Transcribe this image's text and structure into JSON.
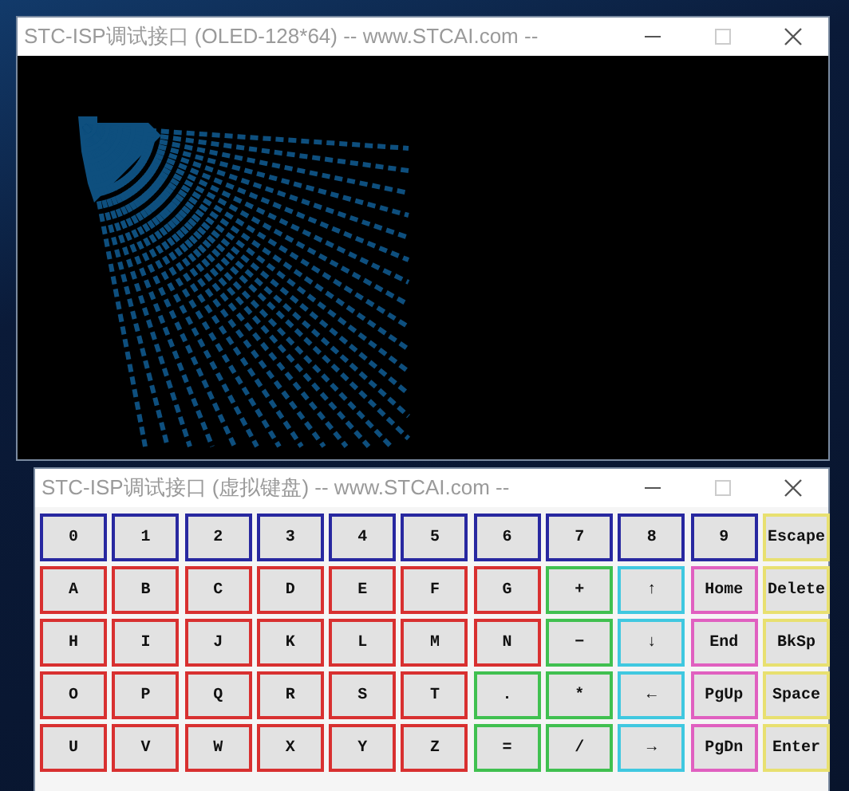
{
  "oled_window": {
    "title": "STC-ISP调试接口 (OLED-128*64) -- www.STCAI.com --"
  },
  "keyboard_window": {
    "title": "STC-ISP调试接口 (虚拟键盘) -- www.STCAI.com --",
    "rows": [
      {
        "keys": [
          {
            "label": "0",
            "color": "#2828a0"
          },
          {
            "label": "1",
            "color": "#2828a0"
          },
          {
            "label": "2",
            "color": "#2828a0"
          },
          {
            "label": "3",
            "color": "#2828a0"
          },
          {
            "label": "4",
            "color": "#2828a0"
          },
          {
            "label": "5",
            "color": "#2828a0"
          },
          {
            "label": "6",
            "color": "#2828a0"
          },
          {
            "label": "7",
            "color": "#2828a0"
          },
          {
            "label": "8",
            "color": "#2828a0"
          },
          {
            "label": "9",
            "color": "#2828a0"
          },
          {
            "label": "Escape",
            "color": "#e8e070"
          }
        ]
      },
      {
        "keys": [
          {
            "label": "A",
            "color": "#d83030"
          },
          {
            "label": "B",
            "color": "#d83030"
          },
          {
            "label": "C",
            "color": "#d83030"
          },
          {
            "label": "D",
            "color": "#d83030"
          },
          {
            "label": "E",
            "color": "#d83030"
          },
          {
            "label": "F",
            "color": "#d83030"
          },
          {
            "label": "G",
            "color": "#d83030"
          },
          {
            "label": "+",
            "color": "#40c050"
          },
          {
            "label": "↑",
            "color": "#40c8e0"
          },
          {
            "label": "Home",
            "color": "#e060c0"
          },
          {
            "label": "Delete",
            "color": "#e8e070"
          }
        ]
      },
      {
        "keys": [
          {
            "label": "H",
            "color": "#d83030"
          },
          {
            "label": "I",
            "color": "#d83030"
          },
          {
            "label": "J",
            "color": "#d83030"
          },
          {
            "label": "K",
            "color": "#d83030"
          },
          {
            "label": "L",
            "color": "#d83030"
          },
          {
            "label": "M",
            "color": "#d83030"
          },
          {
            "label": "N",
            "color": "#d83030"
          },
          {
            "label": "−",
            "color": "#40c050"
          },
          {
            "label": "↓",
            "color": "#40c8e0"
          },
          {
            "label": "End",
            "color": "#e060c0"
          },
          {
            "label": "BkSp",
            "color": "#e8e070"
          }
        ]
      },
      {
        "keys": [
          {
            "label": "O",
            "color": "#d83030"
          },
          {
            "label": "P",
            "color": "#d83030"
          },
          {
            "label": "Q",
            "color": "#d83030"
          },
          {
            "label": "R",
            "color": "#d83030"
          },
          {
            "label": "S",
            "color": "#d83030"
          },
          {
            "label": "T",
            "color": "#d83030"
          },
          {
            "label": ".",
            "color": "#40c050"
          },
          {
            "label": "*",
            "color": "#40c050"
          },
          {
            "label": "←",
            "color": "#40c8e0"
          },
          {
            "label": "PgUp",
            "color": "#e060c0"
          },
          {
            "label": "Space",
            "color": "#e8e070"
          }
        ]
      },
      {
        "keys": [
          {
            "label": "U",
            "color": "#d83030"
          },
          {
            "label": "V",
            "color": "#d83030"
          },
          {
            "label": "W",
            "color": "#d83030"
          },
          {
            "label": "X",
            "color": "#d83030"
          },
          {
            "label": "Y",
            "color": "#d83030"
          },
          {
            "label": "Z",
            "color": "#d83030"
          },
          {
            "label": "=",
            "color": "#40c050"
          },
          {
            "label": "/",
            "color": "#40c050"
          },
          {
            "label": "→",
            "color": "#40c8e0"
          },
          {
            "label": "PgDn",
            "color": "#e060c0"
          },
          {
            "label": "Enter",
            "color": "#e8e070"
          }
        ]
      }
    ]
  }
}
